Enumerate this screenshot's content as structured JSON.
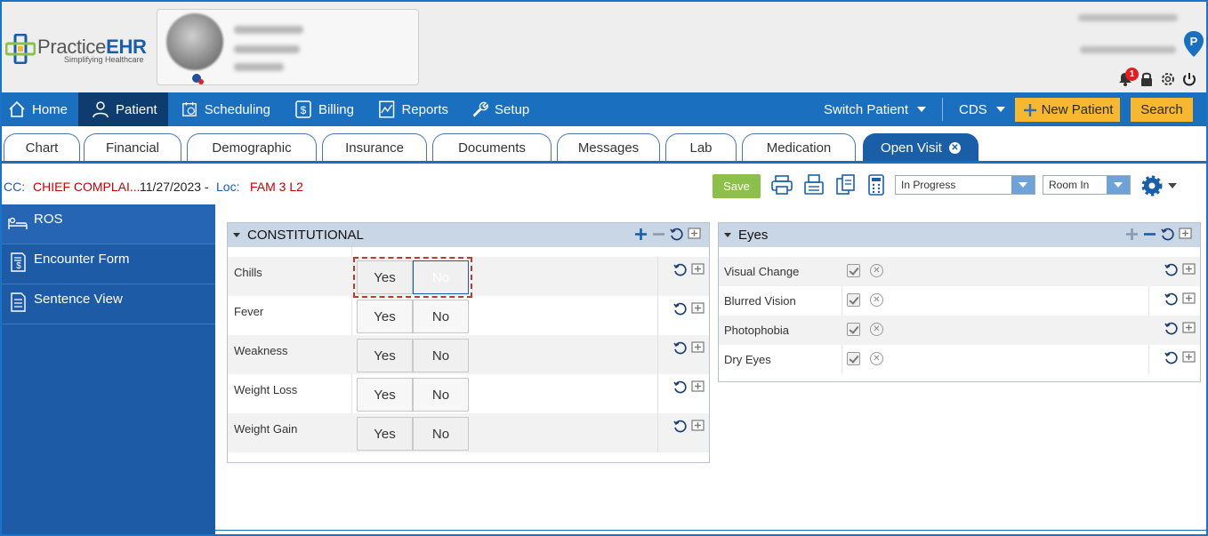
{
  "brand": {
    "name_part1": "Practice",
    "name_part2": "EHR",
    "tagline": "Simplifying Healthcare"
  },
  "header": {
    "notification_count": "1"
  },
  "nav": {
    "items": [
      {
        "label": "Home",
        "icon": "home-icon"
      },
      {
        "label": "Patient",
        "icon": "user-icon"
      },
      {
        "label": "Scheduling",
        "icon": "calendar-clock-icon"
      },
      {
        "label": "Billing",
        "icon": "dollar-icon"
      },
      {
        "label": "Reports",
        "icon": "chart-icon"
      },
      {
        "label": "Setup",
        "icon": "tools-icon"
      }
    ],
    "switch_patient": "Switch Patient",
    "cds": "CDS",
    "new_patient": "New Patient",
    "search": "Search"
  },
  "tabs": [
    {
      "label": "Chart"
    },
    {
      "label": "Financial"
    },
    {
      "label": "Demographic"
    },
    {
      "label": "Insurance"
    },
    {
      "label": "Documents"
    },
    {
      "label": "Messages"
    },
    {
      "label": "Lab"
    },
    {
      "label": "Medication"
    },
    {
      "label": "Open Visit"
    }
  ],
  "toolbar": {
    "cc_label": "CC:",
    "cc_value": "CHIEF COMPLAI...",
    "date": "11/27/2023 -",
    "loc_label": "Loc:",
    "loc_value": "FAM 3 L2",
    "save": "Save",
    "status": "In Progress",
    "room": "Room In"
  },
  "sidebar": {
    "items": [
      {
        "label": "ROS"
      },
      {
        "label": "Encounter Form"
      },
      {
        "label": "Sentence View"
      }
    ]
  },
  "constitutional": {
    "title": "CONSTITUTIONAL",
    "yes": "Yes",
    "no": "No",
    "rows": [
      {
        "label": "Chills",
        "selected": "No"
      },
      {
        "label": "Fever",
        "selected": ""
      },
      {
        "label": "Weakness",
        "selected": ""
      },
      {
        "label": "Weight Loss",
        "selected": ""
      },
      {
        "label": "Weight Gain",
        "selected": ""
      }
    ]
  },
  "eyes": {
    "title": "Eyes",
    "rows": [
      {
        "label": "Visual Change"
      },
      {
        "label": "Blurred Vision"
      },
      {
        "label": "Photophobia"
      },
      {
        "label": "Dry Eyes"
      }
    ]
  },
  "colors": {
    "nav": "#1a6fbf",
    "accent": "#f7b731",
    "selected": "#1d5ba6",
    "save": "#8cc04a",
    "alert": "#c40000"
  }
}
